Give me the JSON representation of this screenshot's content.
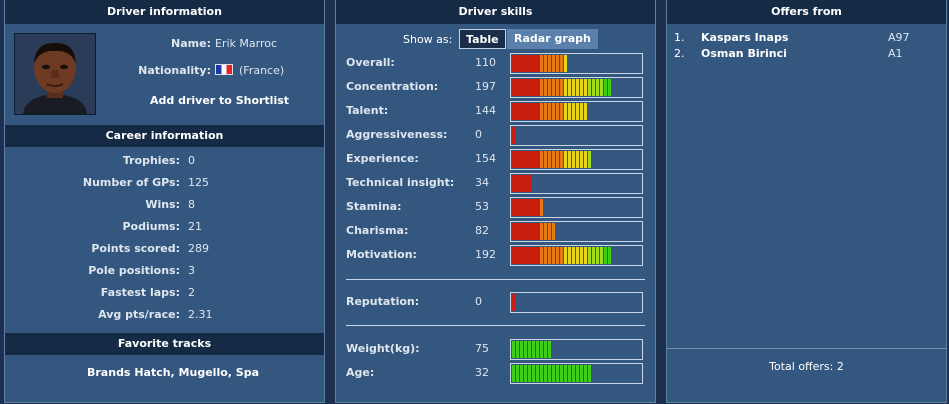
{
  "driver_info": {
    "title": "Driver information",
    "name_label": "Name:",
    "name": "Erik Marroc",
    "nationality_label": "Nationality:",
    "nationality": "(France)",
    "shortlist_link": "Add driver to Shortlist"
  },
  "career": {
    "title": "Career information",
    "rows": [
      {
        "label": "Trophies:",
        "value": "0"
      },
      {
        "label": "Number of GPs:",
        "value": "125"
      },
      {
        "label": "Wins:",
        "value": "8"
      },
      {
        "label": "Podiums:",
        "value": "21"
      },
      {
        "label": "Points scored:",
        "value": "289"
      },
      {
        "label": "Pole positions:",
        "value": "3"
      },
      {
        "label": "Fastest laps:",
        "value": "2"
      },
      {
        "label": "Avg pts/race:",
        "value": "2.31"
      }
    ]
  },
  "favorite_tracks": {
    "title": "Favorite tracks",
    "tracks": "Brands Hatch, Mugello, Spa"
  },
  "skills": {
    "title": "Driver skills",
    "show_as_label": "Show as:",
    "table_button": "Table",
    "radar_button": "Radar graph",
    "rows": [
      {
        "label": "Overall:",
        "value": "110",
        "level": 0.45,
        "scale": "perf"
      },
      {
        "label": "Concentration:",
        "value": "197",
        "level": 0.78,
        "scale": "perf"
      },
      {
        "label": "Talent:",
        "value": "144",
        "level": 0.58,
        "scale": "perf"
      },
      {
        "label": "Aggressiveness:",
        "value": "0",
        "level": 0.03,
        "scale": "perf"
      },
      {
        "label": "Experience:",
        "value": "154",
        "level": 0.62,
        "scale": "perf"
      },
      {
        "label": "Technical insight:",
        "value": "34",
        "level": 0.16,
        "scale": "perf"
      },
      {
        "label": "Stamina:",
        "value": "53",
        "level": 0.24,
        "scale": "perf"
      },
      {
        "label": "Charisma:",
        "value": "82",
        "level": 0.35,
        "scale": "perf"
      },
      {
        "label": "Motivation:",
        "value": "192",
        "level": 0.78,
        "scale": "perf"
      }
    ],
    "reputation": {
      "label": "Reputation:",
      "value": "0",
      "level": 0.03,
      "scale": "perf"
    },
    "physical": [
      {
        "label": "Weight(kg):",
        "value": "75",
        "level": 0.32,
        "scale": "green"
      },
      {
        "label": "Age:",
        "value": "32",
        "level": 0.62,
        "scale": "age"
      }
    ]
  },
  "offers": {
    "title": "Offers from",
    "items": [
      {
        "num": "1.",
        "name": "Kaspars Inaps",
        "team": "A97"
      },
      {
        "num": "2.",
        "name": "Osman Birinci",
        "team": "A1"
      }
    ],
    "total": "Total offers: 2"
  },
  "colors": {
    "panel": "#345780",
    "header": "#152a45",
    "bar_red": "#c81e10",
    "bar_yellow": "#e8d418",
    "bar_green": "#3fcd17"
  }
}
